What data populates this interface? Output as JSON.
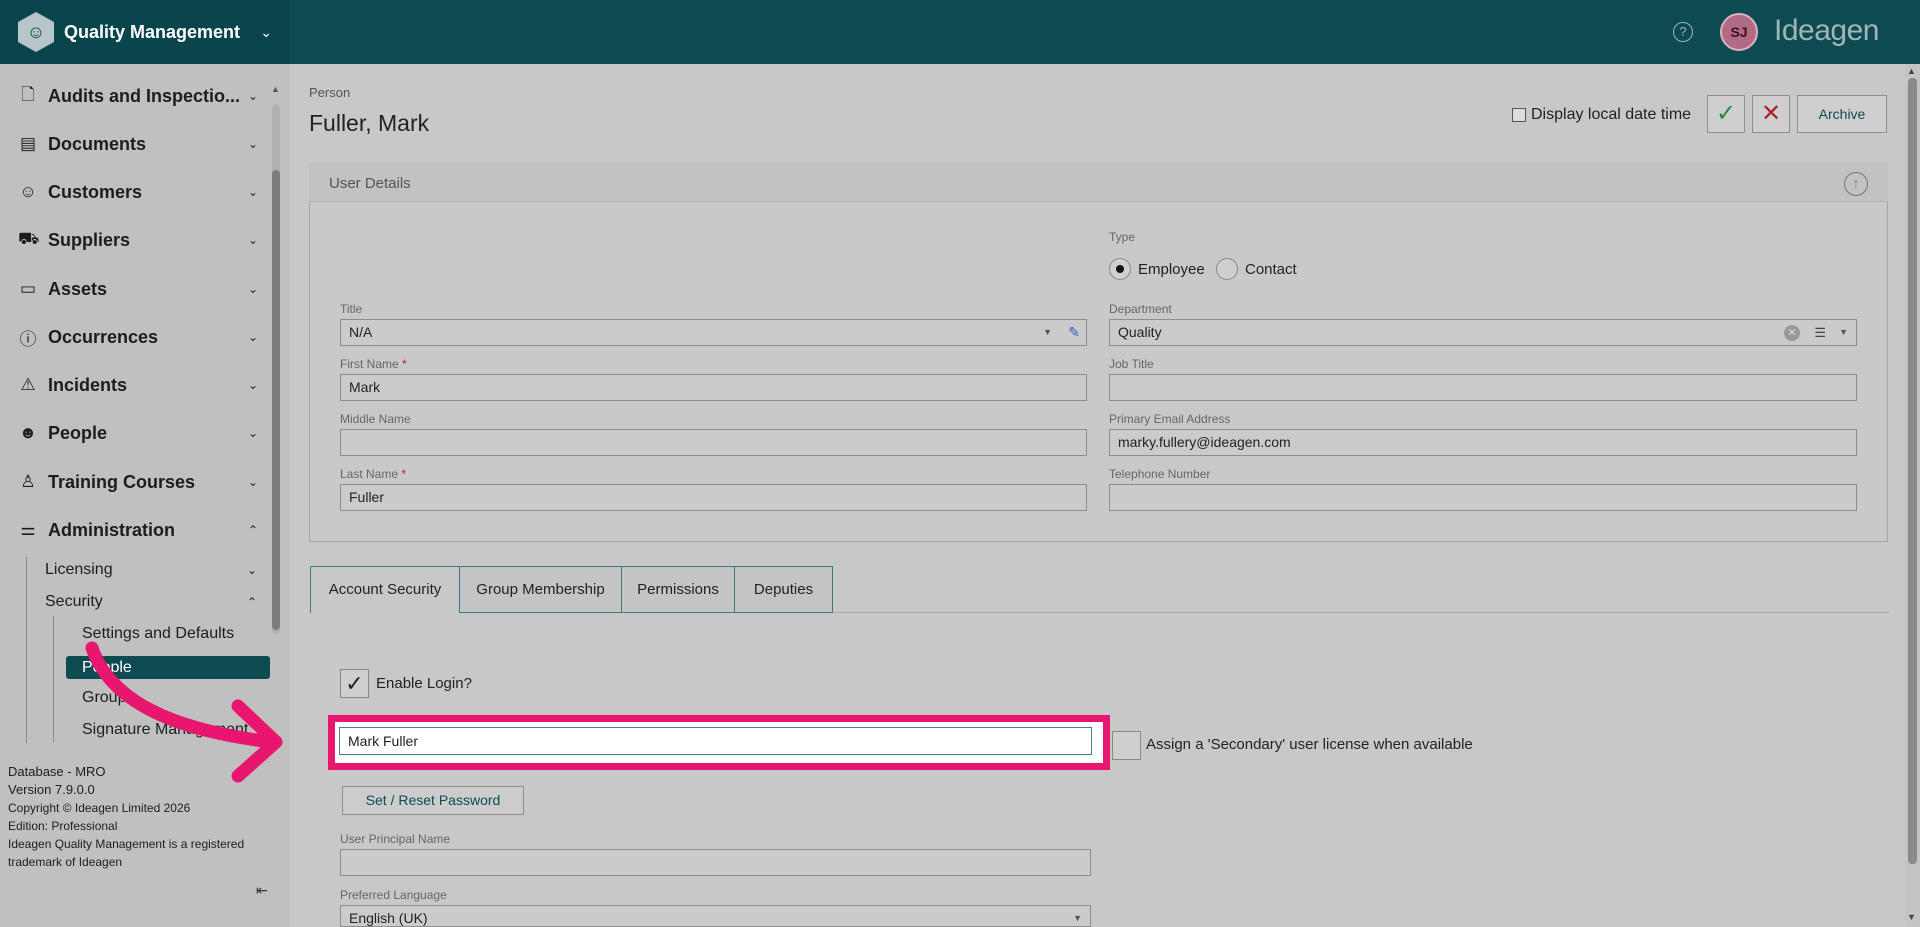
{
  "app": {
    "title": "Quality Management",
    "brand": "Ideagen",
    "avatar_initials": "SJ",
    "help": "?"
  },
  "sidebar": {
    "items": [
      {
        "label": "Audits and Inspectio...",
        "icon": "clipboard-icon"
      },
      {
        "label": "Documents",
        "icon": "document-icon"
      },
      {
        "label": "Customers",
        "icon": "users-icon"
      },
      {
        "label": "Suppliers",
        "icon": "cart-icon"
      },
      {
        "label": "Assets",
        "icon": "archive-box-icon"
      },
      {
        "label": "Occurrences",
        "icon": "alert-circle-icon"
      },
      {
        "label": "Incidents",
        "icon": "warning-triangle-icon"
      },
      {
        "label": "People",
        "icon": "people-icon"
      },
      {
        "label": "Training Courses",
        "icon": "trainee-icon"
      },
      {
        "label": "Administration",
        "icon": "sliders-icon"
      }
    ],
    "admin_sub": [
      "Licensing",
      "Security"
    ],
    "security_sub": [
      "Settings and Defaults",
      "People",
      "Groups",
      "Signature Management"
    ],
    "footer": {
      "database": "Database - MRO",
      "version": "Version 7.9.0.0",
      "copyright": "Copyright © Ideagen Limited 2026",
      "edition": "Edition: Professional",
      "trademark_1": "Ideagen Quality Management is a registered",
      "trademark_2": "trademark of Ideagen"
    }
  },
  "header": {
    "breadcrumb": "Person",
    "title": "Fuller, Mark",
    "display_local": "Display local date time",
    "archive": "Archive"
  },
  "user_details": {
    "section_title": "User Details",
    "type_label": "Type",
    "type_options": [
      "Employee",
      "Contact"
    ],
    "type_selected": "Employee",
    "title_label": "Title",
    "title_value": "N/A",
    "first_name_label": "First Name",
    "first_name": "Mark",
    "middle_name_label": "Middle Name",
    "middle_name": "",
    "last_name_label": "Last Name",
    "last_name": "Fuller",
    "required_mark": "*",
    "department_label": "Department",
    "department": "Quality",
    "job_title_label": "Job Title",
    "job_title": "",
    "email_label": "Primary Email Address",
    "email": "marky.fullery@ideagen.com",
    "phone_label": "Telephone Number",
    "phone": ""
  },
  "tabs": [
    "Account Security",
    "Group Membership",
    "Permissions",
    "Deputies"
  ],
  "account_security": {
    "enable_login": "Enable Login?",
    "login_name_value": "Mark Fuller",
    "secondary_license": "Assign a 'Secondary' user license when available",
    "reset_password": "Set / Reset Password",
    "upn_label": "User Principal Name",
    "upn": "",
    "language_label": "Preferred Language",
    "language": "English (UK)"
  },
  "colors": {
    "teal": "#0e4a51",
    "highlight": "#e8166f"
  }
}
